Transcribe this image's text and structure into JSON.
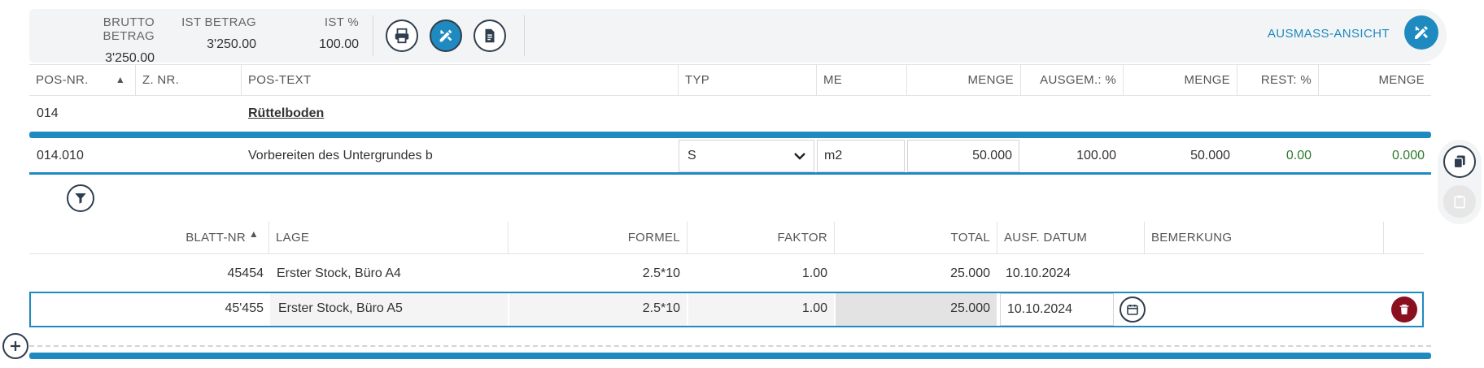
{
  "summary": {
    "brutto_label": "BRUTTO BETRAG",
    "brutto_value": "3'250.00",
    "ist_label": "IST BETRAG",
    "ist_value": "3'250.00",
    "ist_pct_label": "IST %",
    "ist_pct_value": "100.00",
    "ausmass_link": "AUSMASS-ANSICHT"
  },
  "columns": {
    "pos_nr": "POS-NR.",
    "z_nr": "Z. NR.",
    "pos_text": "POS-TEXT",
    "typ": "TYP",
    "me": "ME",
    "menge1": "MENGE",
    "ausgem": "AUSGEM.: %",
    "menge2": "MENGE",
    "rest": "REST: %",
    "menge3": "MENGE"
  },
  "group": {
    "pos_nr": "014",
    "title": "Rüttelboden"
  },
  "position": {
    "pos_nr": "014.010",
    "text": "Vorbereiten des Untergrundes b",
    "typ": "S",
    "me": "m2",
    "menge": "50.000",
    "ausgem_pct": "100.00",
    "ausgem_menge": "50.000",
    "rest_pct": "0.00",
    "rest_menge": "0.000"
  },
  "sub_columns": {
    "blatt_nr": "BLATT-NR",
    "lage": "LAGE",
    "formel": "FORMEL",
    "faktor": "FAKTOR",
    "total": "TOTAL",
    "ausf_datum": "AUSF. DATUM",
    "bemerkung": "BEMERKUNG"
  },
  "sub_rows": [
    {
      "blatt_nr": "45454",
      "lage": "Erster Stock, Büro A4",
      "formel": "2.5*10",
      "faktor": "1.00",
      "total": "25.000",
      "datum": "10.10.2024"
    },
    {
      "blatt_nr": "45'455",
      "lage": "Erster Stock, Büro A5",
      "formel": "2.5*10",
      "faktor": "1.00",
      "total": "25.000",
      "datum": "10.10.2024"
    }
  ],
  "colors": {
    "accent": "#1f8ac0",
    "dark": "#2f3e4e",
    "danger": "#8a1020",
    "positive": "#2f7a2f"
  }
}
